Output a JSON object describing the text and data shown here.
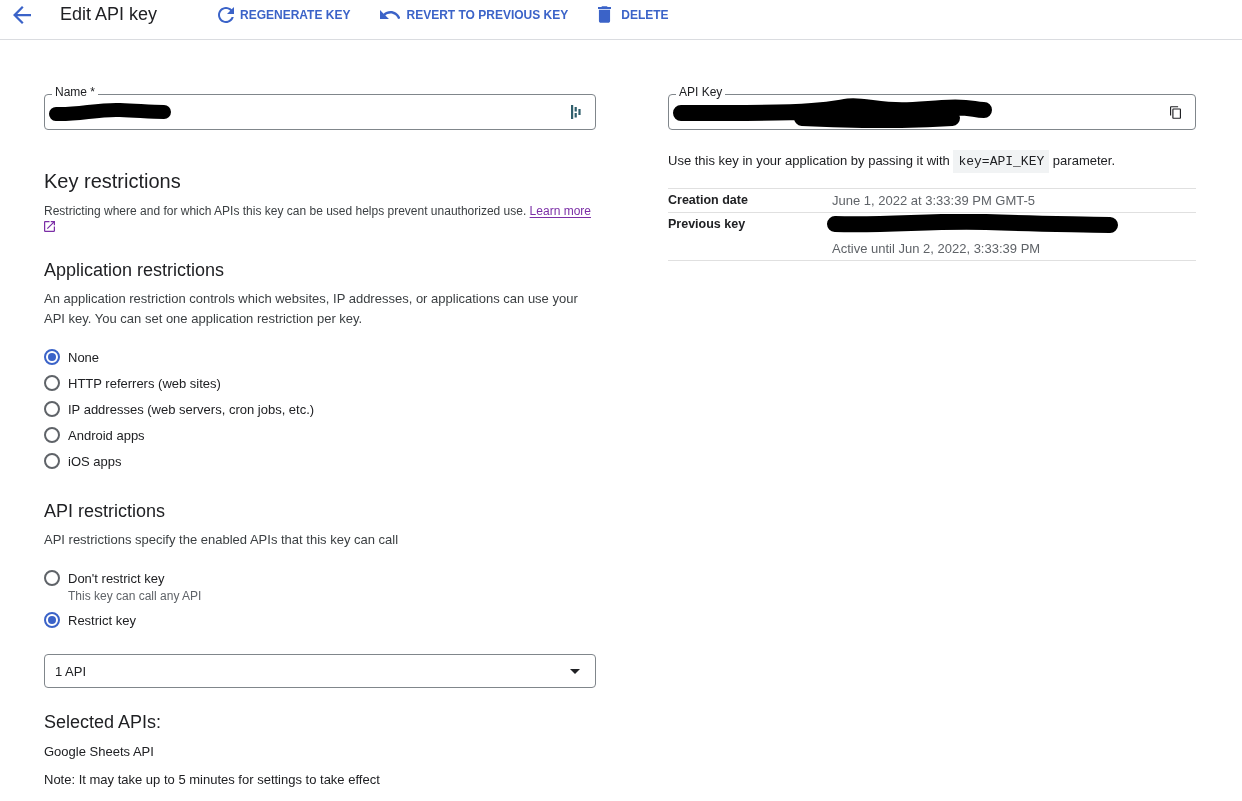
{
  "header": {
    "title": "Edit API key",
    "actions": [
      {
        "kind": "regenerate",
        "label": "REGENERATE KEY"
      },
      {
        "kind": "revert",
        "label": "REVERT TO PREVIOUS KEY"
      },
      {
        "kind": "delete",
        "label": "DELETE"
      }
    ]
  },
  "name_field": {
    "label": "Name *",
    "redacted": true
  },
  "key_restrictions": {
    "heading": "Key restrictions",
    "description": "Restricting where and for which APIs this key can be used helps prevent unauthorized use.",
    "link": "Learn more"
  },
  "application_restrictions": {
    "heading": "Application restrictions",
    "description": "An application restriction controls which websites, IP addresses, or applications can use your API key. You can set one application restriction per key.",
    "options": [
      {
        "label": "None",
        "selected": true
      },
      {
        "label": "HTTP referrers (web sites)",
        "selected": false
      },
      {
        "label": "IP addresses (web servers, cron jobs, etc.)",
        "selected": false
      },
      {
        "label": "Android apps",
        "selected": false
      },
      {
        "label": "iOS apps",
        "selected": false
      }
    ]
  },
  "api_restrictions": {
    "heading": "API restrictions",
    "description": "API restrictions specify the enabled APIs that this key can call",
    "options": [
      {
        "label": "Don't restrict key",
        "hint": "This key can call any API",
        "selected": false
      },
      {
        "label": "Restrict key",
        "selected": true
      }
    ],
    "dropdown": {
      "value": "1 API"
    },
    "selected_heading": "Selected APIs:",
    "selected_apis": [
      "Google Sheets API"
    ],
    "note": "Note: It may take up to 5 minutes for settings to take effect"
  },
  "api_key": {
    "label": "API Key",
    "redacted": true,
    "usage": {
      "before": "Use this key in your application by passing it with",
      "code": "key=API_KEY",
      "after": "parameter."
    },
    "details": [
      {
        "label": "Creation date",
        "redacted": false,
        "value": "June 1, 2022 at 3:33:39 PM GMT-5"
      },
      {
        "label": "Previous key",
        "redacted": true,
        "value": "Active until Jun 2, 2022, 3:33:39 PM"
      }
    ]
  }
}
